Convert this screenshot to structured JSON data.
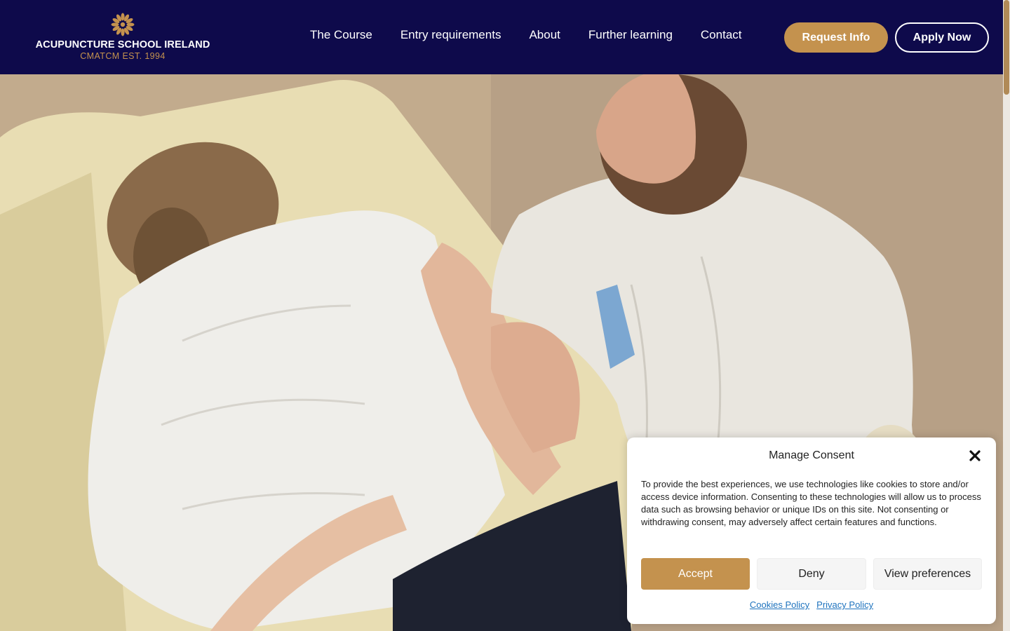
{
  "header": {
    "logo": {
      "title": "ACUPUNCTURE SCHOOL IRELAND",
      "subtitle": "CMATCM EST. 1994",
      "icon": "sun-flower-icon"
    },
    "nav": [
      {
        "label": "The Course"
      },
      {
        "label": "Entry requirements"
      },
      {
        "label": "About"
      },
      {
        "label": "Further learning"
      },
      {
        "label": "Contact"
      }
    ],
    "request_label": "Request Info",
    "apply_label": "Apply Now"
  },
  "colors": {
    "header_bg": "#0e0a4b",
    "accent": "#c4924e",
    "link": "#1e73be"
  },
  "hero": {
    "image": "photo of acupuncture practitioner treating a patient lying on a couch"
  },
  "consent": {
    "title": "Manage Consent",
    "text": "To provide the best experiences, we use technologies like cookies to store and/or access device information. Consenting to these technologies will allow us to process data such as browsing behavior or unique IDs on this site. Not consenting or withdrawing consent, may adversely affect certain features and functions.",
    "accept_label": "Accept",
    "deny_label": "Deny",
    "preferences_label": "View preferences",
    "links": [
      "Cookies Policy",
      "Privacy Policy"
    ]
  }
}
